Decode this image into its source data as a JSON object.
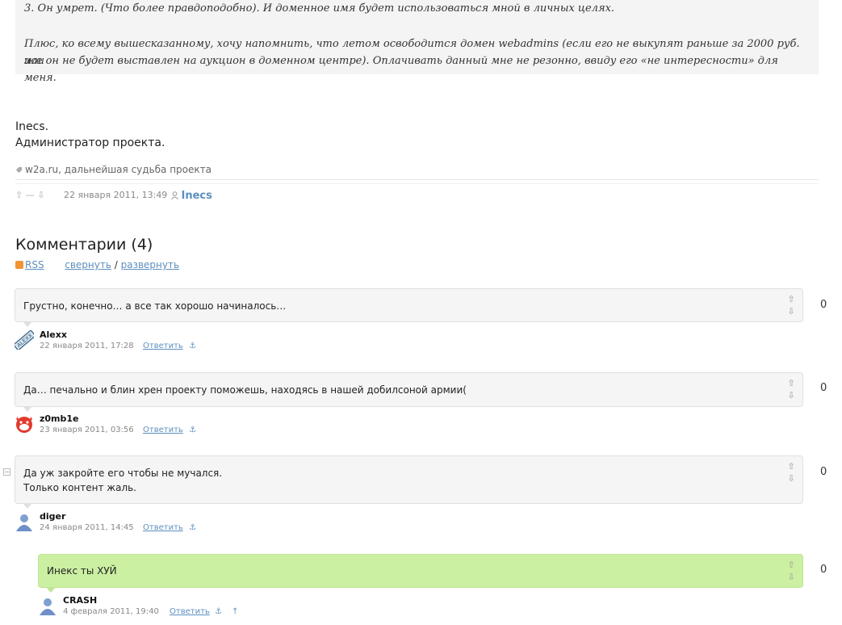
{
  "post": {
    "quote_lines": [
      "3. Он умрет. (Что более правдоподобно). И доменное имя будет использоваться мной в личных целях.",
      "Плюс, ко всему вышесказанному, хочу напомнить, что летом освободится домен webadmins (если его не выкупят раньше за 2000 руб. или",
      "же он не будет выставлен на аукцион в доменном центре). Оплачивать данный мне не резонно, ввиду его «не интересности» для меня."
    ],
    "signature_name": "Inecs.",
    "signature_role": "Администратор проекта.",
    "tags": "w2a.ru, дальнейшая судьба проекта",
    "vote_display": "⇧ — ⇩",
    "date": "22 января 2011, 13:49",
    "author": "Inecs"
  },
  "comments_section": {
    "title": "Комментарии (4)",
    "rss": "RSS",
    "collapse": "свернуть",
    "slash": "/",
    "expand": "развернуть"
  },
  "comments": [
    {
      "text_lines": [
        "Грустно, конечно… а все так хорошо начиналось…"
      ],
      "score": "0",
      "user": "Alexx",
      "date": "22 января 2011, 17:28",
      "reply": "Ответить",
      "anchor": "⚓"
    },
    {
      "text_lines": [
        "Да… печально и блин хрен проекту поможешь, находясь в нашей добилсоной армии("
      ],
      "score": "0",
      "user": "z0mb1e",
      "date": "23 января 2011, 03:56",
      "reply": "Ответить",
      "anchor": "⚓"
    },
    {
      "text_lines": [
        "Да уж закройте его чтобы не мучался.",
        "Только контент жаль."
      ],
      "score": "0",
      "user": "diger",
      "date": "24 января 2011, 14:45",
      "reply": "Ответить",
      "anchor": "⚓"
    },
    {
      "text_lines": [
        "Инекс ты ХУЙ"
      ],
      "score": "0",
      "user": "CRASH",
      "date": "4 февраля 2011, 19:40",
      "reply": "Ответить",
      "anchor": "⚓",
      "parent": "↑"
    }
  ],
  "icons": {
    "vote_up": "⇧",
    "vote_down": "⇩",
    "collapse": "−"
  },
  "colors": {
    "link": "#5d8fbf",
    "comment_bg": "#f5f5f5",
    "highlight_bg": "#ccf0a2",
    "rss": "#f29434"
  }
}
